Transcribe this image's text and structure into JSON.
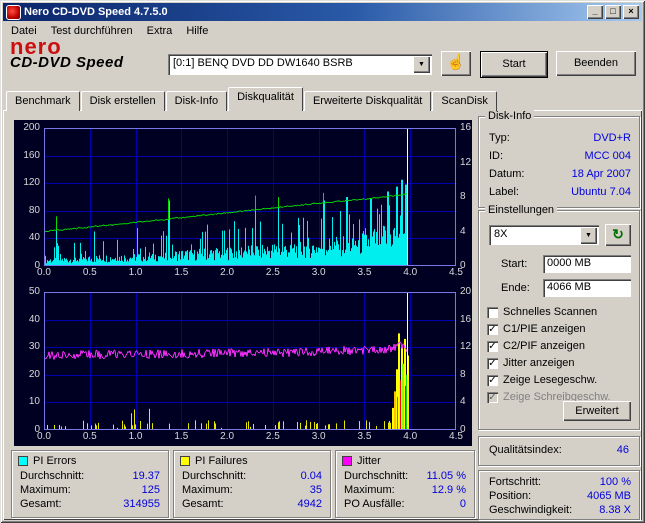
{
  "window": {
    "title": "Nero CD-DVD Speed 4.7.5.0"
  },
  "icons": {
    "minimize": "_",
    "maximize": "□",
    "close": "×",
    "dropdown": "▼",
    "hand": "☝",
    "refresh": "↻",
    "check": "✓"
  },
  "menu": {
    "items": [
      "Datei",
      "Test durchführen",
      "Extra",
      "Hilfe"
    ]
  },
  "toolbar": {
    "logo_top": "nero",
    "logo_bottom": "CD-DVD Speed",
    "drive_select": "[0:1]   BENQ DVD DD DW1640 BSRB",
    "start_label": "Start",
    "quit_label": "Beenden"
  },
  "tabs": {
    "items": [
      "Benchmark",
      "Disk erstellen",
      "Disk-Info",
      "Diskqualität",
      "Erweiterte Diskqualität",
      "ScanDisk"
    ],
    "active": "Diskqualität"
  },
  "disk_info": {
    "title": "Disk-Info",
    "rows": [
      {
        "label": "Typ:",
        "value": "DVD+R"
      },
      {
        "label": "ID:",
        "value": "MCC 004"
      },
      {
        "label": "Datum:",
        "value": "18 Apr 2007"
      },
      {
        "label": "Label:",
        "value": "Ubuntu 7.04"
      }
    ]
  },
  "settings": {
    "title": "Einstellungen",
    "speed_value": "8X",
    "start_label": "Start:",
    "start_value": "0000 MB",
    "end_label": "Ende:",
    "end_value": "4066 MB",
    "checkboxes": [
      {
        "label": "Schnelles Scannen",
        "checked": false,
        "disabled": false
      },
      {
        "label": "C1/PIE anzeigen",
        "checked": true,
        "disabled": false
      },
      {
        "label": "C2/PIF anzeigen",
        "checked": true,
        "disabled": false
      },
      {
        "label": "Jitter anzeigen",
        "checked": true,
        "disabled": false
      },
      {
        "label": "Zeige Lesegeschw.",
        "checked": true,
        "disabled": false
      },
      {
        "label": "Zeige Schreibgeschw.",
        "checked": true,
        "disabled": true
      }
    ],
    "advanced_label": "Erweitert"
  },
  "quality": {
    "label": "Qualitätsindex:",
    "value": "46"
  },
  "progress": {
    "rows": [
      {
        "label": "Fortschritt:",
        "value": "100 %"
      },
      {
        "label": "Position:",
        "value": "4065 MB"
      },
      {
        "label": "Geschwindigkeit:",
        "value": "8.38 X"
      }
    ]
  },
  "panels": [
    {
      "title": "PI Errors",
      "chip": "#00ffff",
      "rows": [
        {
          "label": "Durchschnitt:",
          "value": "19.37"
        },
        {
          "label": "Maximum:",
          "value": "125"
        },
        {
          "label": "Gesamt:",
          "value": "314955"
        }
      ]
    },
    {
      "title": "PI Failures",
      "chip": "#ffff00",
      "rows": [
        {
          "label": "Durchschnitt:",
          "value": "0.04"
        },
        {
          "label": "Maximum:",
          "value": "35"
        },
        {
          "label": "Gesamt:",
          "value": "4942"
        }
      ]
    },
    {
      "title": "Jitter",
      "chip": "#ff00ff",
      "rows": [
        {
          "label": "Durchschnitt:",
          "value": "11.05 %"
        },
        {
          "label": "Maximum:",
          "value": "12.9 %"
        },
        {
          "label": "PO Ausfälle:",
          "value": "0"
        }
      ]
    }
  ],
  "chart_style": {
    "bg": "#000022",
    "grid": "#0000b0",
    "frame": "#7878e8",
    "label": "#d8d8d8"
  },
  "chart_data": [
    {
      "type": "area+line",
      "name": "PIE errors (cyan) and read speed (green)",
      "x_unit": "GB",
      "x_range": [
        0,
        4.5
      ],
      "y_left_range": [
        0,
        200
      ],
      "y_right_range": [
        0,
        16
      ],
      "x_ticks": [
        "0.0",
        "0.5",
        "1.0",
        "1.5",
        "2.0",
        "2.5",
        "3.0",
        "3.5",
        "4.0",
        "4.5"
      ],
      "left_ticks": [
        200,
        160,
        120,
        80,
        40,
        0
      ],
      "right_ticks": [
        16,
        12,
        8,
        4,
        0
      ],
      "end_line_x": 3.97,
      "colors": {
        "pie": "#00eeee",
        "speed": "#00dd00",
        "end_line": "#ffffff"
      },
      "pie_envelope": [
        [
          0,
          10,
          32
        ],
        [
          0.5,
          13,
          40
        ],
        [
          1,
          16,
          48
        ],
        [
          1.5,
          20,
          55
        ],
        [
          2,
          24,
          62
        ],
        [
          2.5,
          28,
          70
        ],
        [
          3,
          33,
          80
        ],
        [
          3.5,
          42,
          92
        ],
        [
          3.8,
          55,
          105
        ],
        [
          3.95,
          70,
          125
        ],
        [
          3.97,
          60,
          110
        ]
      ],
      "pie_spikes": [
        [
          0.13,
          58
        ],
        [
          0.55,
          50
        ],
        [
          1.02,
          55
        ],
        [
          1.35,
          95
        ],
        [
          1.78,
          60
        ],
        [
          2.08,
          65
        ],
        [
          2.3,
          90
        ],
        [
          2.56,
          85
        ],
        [
          2.83,
          70
        ],
        [
          3.05,
          95
        ],
        [
          3.3,
          100
        ],
        [
          3.56,
          98
        ],
        [
          3.75,
          108
        ],
        [
          3.85,
          115
        ],
        [
          3.9,
          125
        ],
        [
          3.94,
          118
        ]
      ],
      "speed_line": [
        [
          0,
          50
        ],
        [
          0.5,
          56.5
        ],
        [
          1,
          63
        ],
        [
          1.5,
          70
        ],
        [
          2,
          77
        ],
        [
          2.5,
          84
        ],
        [
          3,
          91
        ],
        [
          3.5,
          97
        ],
        [
          3.9,
          103
        ],
        [
          3.97,
          105
        ]
      ],
      "speed_spikes": [
        [
          0.13,
          72
        ],
        [
          1.35,
          98
        ],
        [
          2.3,
          102
        ],
        [
          2.56,
          100
        ],
        [
          3.05,
          106
        ]
      ],
      "stats": {
        "pie_average": 19.37,
        "pie_maximum": 125,
        "pie_total": 314955,
        "final_speed_x": 8.38
      }
    },
    {
      "type": "spikes+line",
      "name": "PIF failures (yellow/red/green) and jitter (magenta)",
      "x_unit": "GB",
      "x_range": [
        0,
        4.5
      ],
      "y_left_range": [
        0,
        50
      ],
      "y_right_range": [
        0,
        20
      ],
      "x_ticks": [
        "0.0",
        "0.5",
        "1.0",
        "1.5",
        "2.0",
        "2.5",
        "3.0",
        "3.5",
        "4.0",
        "4.5"
      ],
      "left_ticks": [
        50,
        40,
        30,
        20,
        10,
        0
      ],
      "right_ticks": [
        20,
        16,
        12,
        8,
        4,
        0
      ],
      "end_line_x": 3.97,
      "colors": {
        "pif": "#e8e800",
        "jitter": "#ff30ff",
        "end_line": "#ffffff"
      },
      "jitter_line": [
        [
          0,
          27
        ],
        [
          0.5,
          27.3
        ],
        [
          1,
          27.4
        ],
        [
          1.5,
          27.6
        ],
        [
          2,
          27.9
        ],
        [
          2.5,
          28
        ],
        [
          3,
          28.4
        ],
        [
          3.5,
          29
        ],
        [
          3.75,
          29.3
        ],
        [
          3.85,
          30
        ],
        [
          3.9,
          31.5
        ],
        [
          3.94,
          30
        ],
        [
          3.97,
          28.5
        ]
      ],
      "jitter_noise": 1.6,
      "pif_end_spikes": [
        [
          3.8,
          8,
          "#ffff00"
        ],
        [
          3.82,
          14,
          "#ffc000"
        ],
        [
          3.84,
          22,
          "#ffff00"
        ],
        [
          3.855,
          12,
          "#ff4000"
        ],
        [
          3.87,
          35,
          "#ffff00"
        ],
        [
          3.885,
          18,
          "#ff0000"
        ],
        [
          3.9,
          30,
          "#ffff00"
        ],
        [
          3.915,
          24,
          "#80ff00"
        ],
        [
          3.93,
          33,
          "#ffff00"
        ],
        [
          3.945,
          16,
          "#ff0000"
        ],
        [
          3.955,
          20,
          "#00e000"
        ],
        [
          3.965,
          27,
          "#ffff00"
        ]
      ],
      "stats": {
        "jitter_avg_pct": 11.05,
        "jitter_max_pct": 12.9,
        "po_failures": 0,
        "pif_average": 0.04,
        "pif_maximum": 35,
        "pif_total": 4942
      }
    }
  ]
}
